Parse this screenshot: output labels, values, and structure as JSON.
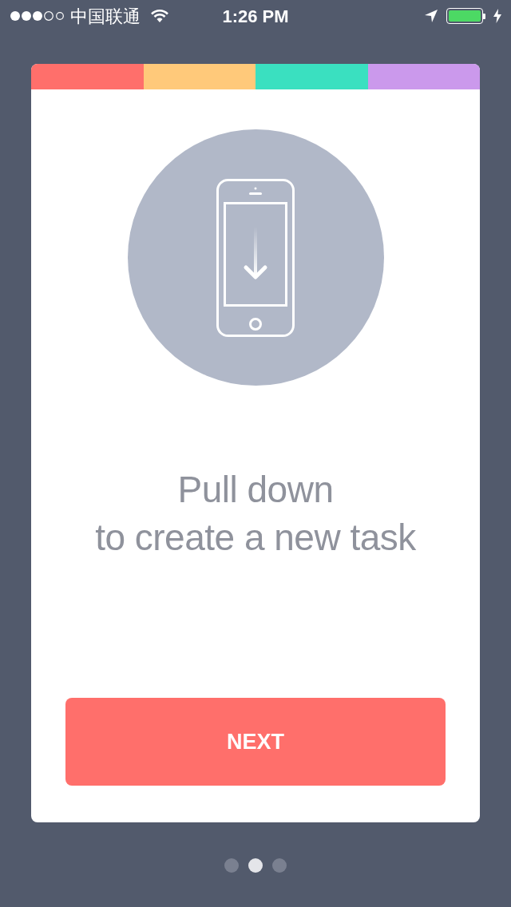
{
  "status_bar": {
    "carrier": "中国联通",
    "time": "1:26 PM"
  },
  "card": {
    "color_strip": [
      {
        "color": "#ff6f6b"
      },
      {
        "color": "#ffc97a"
      },
      {
        "color": "#3ae0c0"
      },
      {
        "color": "#cb99ec"
      }
    ],
    "title_lines": [
      "Pull down",
      "to create a new task"
    ],
    "button": "NEXT"
  },
  "pages": [
    {
      "selected": false
    },
    {
      "selected": true
    },
    {
      "selected": false
    }
  ]
}
